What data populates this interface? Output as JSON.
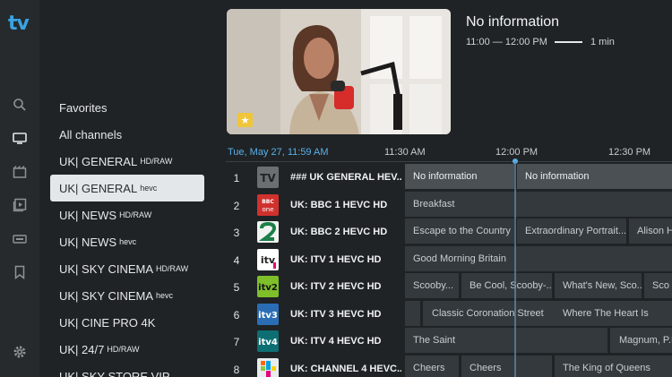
{
  "app": {
    "logo": "tv"
  },
  "rail": [
    {
      "name": "search-icon"
    },
    {
      "name": "tv-icon"
    },
    {
      "name": "movies-icon"
    },
    {
      "name": "series-icon"
    },
    {
      "name": "epg-icon"
    },
    {
      "name": "bookmark-icon"
    },
    {
      "name": "settings-icon"
    }
  ],
  "categories": [
    {
      "label": "Favorites",
      "sup": ""
    },
    {
      "label": "All channels",
      "sup": ""
    },
    {
      "label": "UK| GENERAL",
      "sup": "HD/RAW"
    },
    {
      "label": "UK| GENERAL",
      "sup": "hevc"
    },
    {
      "label": "UK| NEWS",
      "sup": "HD/RAW"
    },
    {
      "label": "UK| NEWS",
      "sup": "hevc"
    },
    {
      "label": "UK| SKY CINEMA",
      "sup": "HD/RAW"
    },
    {
      "label": "UK| SKY CINEMA",
      "sup": "hevc"
    },
    {
      "label": "UK| CINE PRO 4K",
      "sup": ""
    },
    {
      "label": "UK| 24/7",
      "sup": "HD/RAW"
    },
    {
      "label": "UK| SKY STORE VIP",
      "sup": ""
    }
  ],
  "now_playing": {
    "title": "No information",
    "time": "11:00 — 12:00 PM",
    "duration": "1 min",
    "progress": 0.95
  },
  "guide": {
    "date": "Tue, May 27, 11:59 AM",
    "ticks": [
      "11:30 AM",
      "12:00 PM",
      "12:30 PM"
    ],
    "channels": [
      {
        "num": "1",
        "name": "### UK GENERAL HEV...",
        "programs": [
          "No information",
          "No information"
        ]
      },
      {
        "num": "2",
        "name": "UK: BBC 1 HEVC HD",
        "programs": [
          "Breakfast"
        ]
      },
      {
        "num": "3",
        "name": "UK: BBC 2 HEVC HD",
        "programs": [
          "Escape to the Country",
          "Extraordinary Portrait...",
          "Alison H"
        ]
      },
      {
        "num": "4",
        "name": "UK: ITV 1 HEVC HD",
        "programs": [
          "Good Morning Britain"
        ]
      },
      {
        "num": "5",
        "name": "UK: ITV 2 HEVC HD",
        "programs": [
          "Scooby...",
          "Be Cool, Scooby-...",
          "What's New, Sco...",
          "Sco"
        ]
      },
      {
        "num": "6",
        "name": "UK: ITV 3 HEVC HD",
        "programs": [
          "Classic Coronation Street",
          "Where The Heart Is"
        ]
      },
      {
        "num": "7",
        "name": "UK: ITV 4 HEVC HD",
        "programs": [
          "The Saint",
          "Magnum, P.I."
        ]
      },
      {
        "num": "8",
        "name": "UK: CHANNEL 4 HEVC...",
        "programs": [
          "Cheers",
          "Cheers",
          "The King of Queens"
        ]
      }
    ]
  }
}
